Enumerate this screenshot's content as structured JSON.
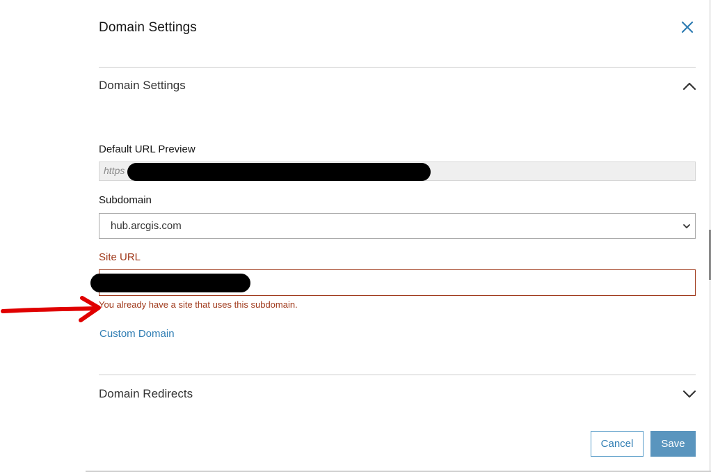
{
  "dialog": {
    "title": "Domain Settings",
    "close_icon": "close-icon",
    "accent_color": "#2f7db3",
    "error_color": "#a03a1c"
  },
  "domain_settings_section": {
    "title": "Domain Settings",
    "toggle_icon": "chevron-up-icon",
    "default_url_preview": {
      "label": "Default URL Preview",
      "value": "https"
    },
    "subdomain": {
      "label": "Subdomain",
      "selected": "hub.arcgis.com"
    },
    "site_url": {
      "label": "Site URL",
      "value": "",
      "error": "You already have a site that uses this subdomain."
    },
    "custom_domain_link": "Custom Domain"
  },
  "domain_redirects_section": {
    "title": "Domain Redirects",
    "toggle_icon": "chevron-down-icon"
  },
  "footer": {
    "cancel_label": "Cancel",
    "save_label": "Save"
  },
  "annotations": {
    "arrow_icon": "red-arrow-icon",
    "arrow_color": "#e00000",
    "redaction_color": "#000000"
  }
}
